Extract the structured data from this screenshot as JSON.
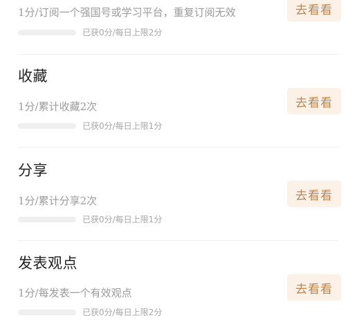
{
  "tasks": [
    {
      "title": "",
      "desc": "1分/订阅一个强国号或学习平台，重复订阅无效",
      "progress_text": "已获0分/每日上限2分",
      "progress": 0,
      "button_label": "去看看"
    },
    {
      "title": "收藏",
      "desc": "1分/累计收藏2次",
      "progress_text": "已获0分/每日上限1分",
      "progress": 0,
      "button_label": "去看看"
    },
    {
      "title": "分享",
      "desc": "1分/累计分享2次",
      "progress_text": "已获0分/每日上限1分",
      "progress": 0,
      "button_label": "去看看"
    },
    {
      "title": "发表观点",
      "desc": "1分/每发表一个有效观点",
      "progress_text": "已获0分/每日上限2分",
      "progress": 0,
      "button_label": "去看看"
    }
  ],
  "colors": {
    "accent": "#b98653",
    "button_bg": "#fcf1e6",
    "progress_track": "#efefef"
  }
}
